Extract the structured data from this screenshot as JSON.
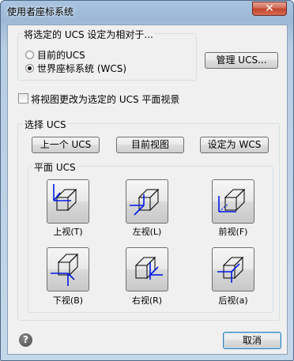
{
  "window": {
    "title": "使用者座标系统",
    "close_symbol": "✕"
  },
  "relative": {
    "group_label": "将选定的 UCS 设定为相对于...",
    "options": [
      {
        "label": "目前的UCS",
        "selected": false
      },
      {
        "label": "世界座标系统 (WCS)",
        "selected": true
      }
    ],
    "manage_button": "管理 UCS..."
  },
  "change_view": {
    "label": "将视图更改为选定的 UCS 平面视景",
    "checked": false
  },
  "select_ucs": {
    "group_label": "选择 UCS",
    "buttons": {
      "previous": "上一个 UCS",
      "current_view": "目前视图",
      "set_wcs": "设定为 WCS"
    },
    "plane": {
      "group_label": "平面 UCS",
      "views": [
        {
          "label": "上视(T)",
          "icon": "top-view-icon"
        },
        {
          "label": "左视(L)",
          "icon": "left-view-icon"
        },
        {
          "label": "前视(F)",
          "icon": "front-view-icon"
        },
        {
          "label": "下视(B)",
          "icon": "bottom-view-icon"
        },
        {
          "label": "右视(R)",
          "icon": "right-view-icon"
        },
        {
          "label": "后视(a)",
          "icon": "back-view-icon"
        }
      ]
    }
  },
  "footer": {
    "help_symbol": "?",
    "cancel_button": "取消"
  },
  "colors": {
    "axis": "#0018e8",
    "cube": "#000000"
  }
}
